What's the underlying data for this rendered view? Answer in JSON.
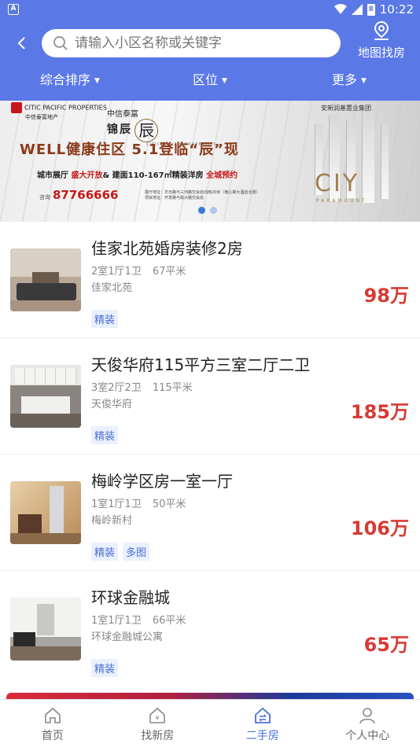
{
  "status_bar": {
    "time": "10:22",
    "notification_glyph": "A",
    "battery_glyph": "8"
  },
  "header": {
    "search_placeholder": "请输入小区名称或关键字",
    "map_button_label": "地图找房",
    "filters": [
      {
        "label": "综合排序"
      },
      {
        "label": "区位"
      },
      {
        "label": "更多"
      }
    ]
  },
  "banner": {
    "brand_en": "CITIC PACIFIC PROPERTIES",
    "brand_cn": "中信泰富地产",
    "project_top": "中信泰富",
    "project_name": "锦辰",
    "project_glyph": "辰",
    "project_en": "CITIC PACIFIC PROPERTIES",
    "developer": "安新润基置业集团",
    "headline": "WELL健康住区 5.1登临“辰”现",
    "sub_prefix": "城市展厅 ",
    "sub_red1": "盛大开放",
    "sub_middle": "& 建面110-167㎡精装洋房 ",
    "sub_red2": "全城预约",
    "phone_label": "咨询",
    "phone": "87766666",
    "address": "展厅地址：华日路与三河路交会处向南20米（南心锦大酒店北侧）项目地址：开发路与陈大路交会处",
    "city_logo": "CIY",
    "city_logo_sub": "PARAMOUNT",
    "page_count": 2,
    "active_page": 1
  },
  "listings": [
    {
      "title": "佳家北苑婚房装修2房",
      "layout": "2室1厅1卫",
      "area": "67平米",
      "community": "佳家北苑",
      "price": "98万",
      "tags": [
        "精装"
      ]
    },
    {
      "title": "天俊华府115平方三室二厅二卫",
      "layout": "3室2厅2卫",
      "area": "115平米",
      "community": "天俊华府",
      "price": "185万",
      "tags": [
        "精装"
      ]
    },
    {
      "title": "梅岭学区房一室一厅",
      "layout": "1室1厅1卫",
      "area": "50平米",
      "community": "梅岭新村",
      "price": "106万",
      "tags": [
        "精装",
        "多图"
      ]
    },
    {
      "title": "环球金融城",
      "layout": "1室1厅1卫",
      "area": "66平米",
      "community": "环球金融城公寓",
      "price": "65万",
      "tags": [
        "精装"
      ]
    }
  ],
  "tabbar": [
    {
      "label": "首页",
      "icon": "home-icon",
      "active": false
    },
    {
      "label": "找新房",
      "icon": "new-house-icon",
      "active": false
    },
    {
      "label": "二手房",
      "icon": "second-hand-house-icon",
      "active": true
    },
    {
      "label": "个人中心",
      "icon": "person-icon",
      "active": false
    }
  ],
  "colors": {
    "primary": "#5a78e6",
    "price": "#d63b34",
    "tab_active": "#4a6fd8"
  }
}
